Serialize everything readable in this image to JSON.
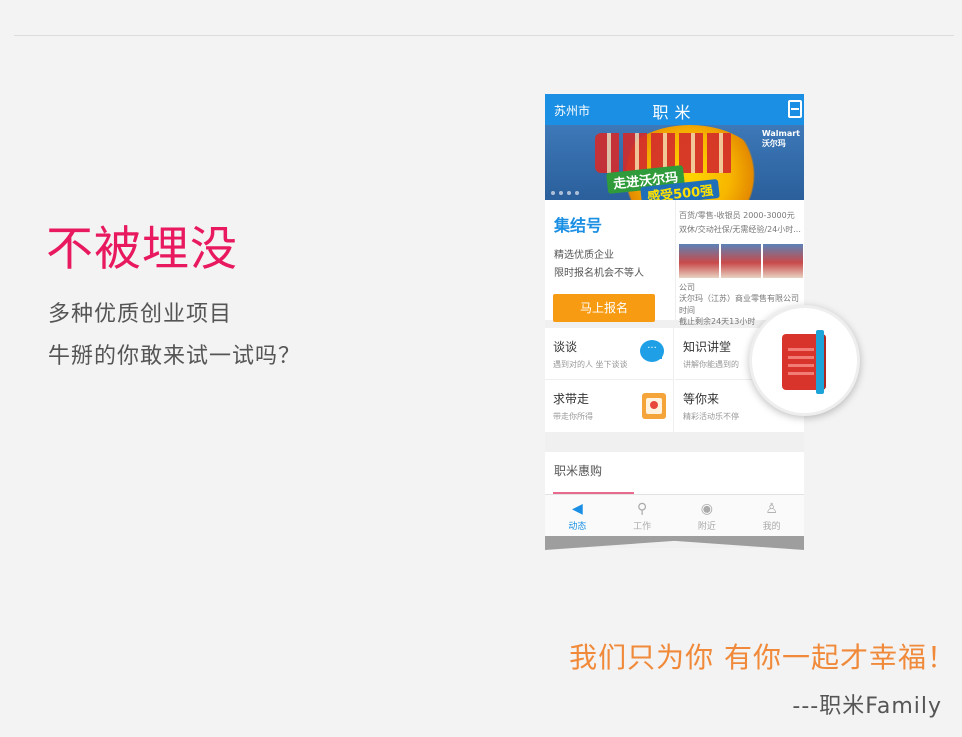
{
  "headline": "不被埋没",
  "subline1": "多种优质创业项目",
  "subline2": "牛掰的你敢来试一试吗？",
  "slogan": "我们只为你 有你一起才幸福！",
  "signature": "---职米Family",
  "phone": {
    "city": "苏州市",
    "app_title": "职米",
    "banner": {
      "promo_line1": "走进沃尔玛",
      "promo_line2": "感受500强",
      "brand_line1": "Walmart",
      "brand_line2": "沃尔玛"
    },
    "gather": {
      "title": "集结号",
      "line1": "精选优质企业",
      "line2": "限时报名机会不等人",
      "button": "马上报名",
      "job_line1": "百货/零售-收银员   2000-3000元",
      "job_line2": "双休/交动社保/无需经验/24小时...",
      "company_label": "公司",
      "company_name": "沃尔玛（江苏）商业零售有限公司",
      "time_label": "时间",
      "deadline": "截止剩余24天13小时"
    },
    "grid": [
      {
        "title": "谈谈",
        "sub": "遇到对的人 坐下谈谈"
      },
      {
        "title": "知识讲堂",
        "sub": "讲解你能遇到的"
      },
      {
        "title": "求带走",
        "sub": "带走你所得"
      },
      {
        "title": "等你来",
        "sub": "精彩活动乐不停"
      }
    ],
    "benefits_title": "职米惠购",
    "tabs": [
      {
        "label": "动态",
        "icon": "megaphone-icon"
      },
      {
        "label": "工作",
        "icon": "search-icon"
      },
      {
        "label": "附近",
        "icon": "location-icon"
      },
      {
        "label": "我的",
        "icon": "user-icon"
      }
    ]
  }
}
